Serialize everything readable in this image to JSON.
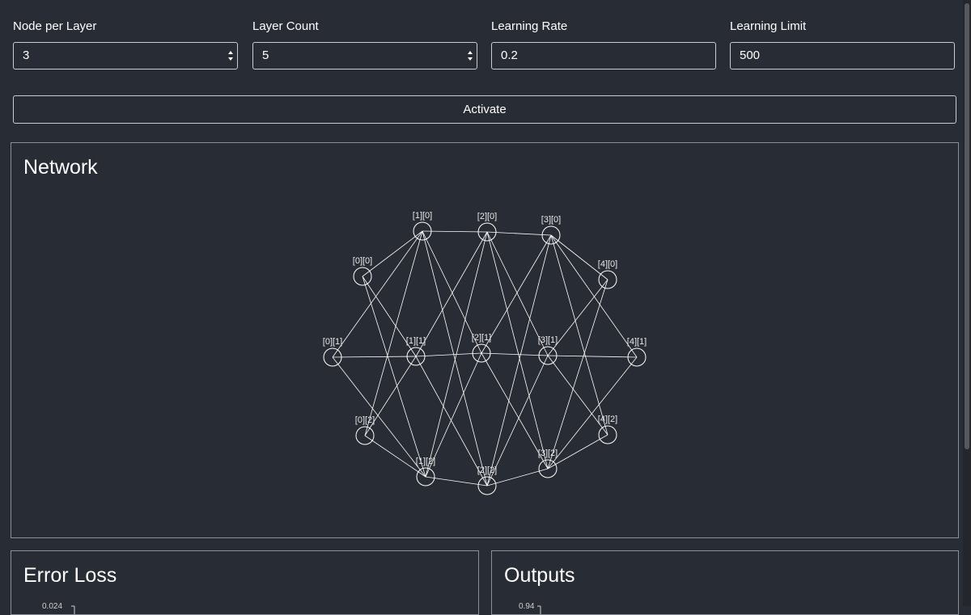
{
  "controls": {
    "node_per_layer": {
      "label": "Node per Layer",
      "value": "3"
    },
    "layer_count": {
      "label": "Layer Count",
      "value": "5"
    },
    "learning_rate": {
      "label": "Learning Rate",
      "value": "0.2"
    },
    "learning_limit": {
      "label": "Learning Limit",
      "value": "500"
    },
    "activate_label": "Activate"
  },
  "network": {
    "title": "Network",
    "nodes": [
      {
        "label": "[0][0]"
      },
      {
        "label": "[0][1]"
      },
      {
        "label": "[0][2]"
      },
      {
        "label": "[1][0]"
      },
      {
        "label": "[1][1]"
      },
      {
        "label": "[1][2]"
      },
      {
        "label": "[2][0]"
      },
      {
        "label": "[2][1]"
      },
      {
        "label": "[2][2]"
      },
      {
        "label": "[3][0]"
      },
      {
        "label": "[3][1]"
      },
      {
        "label": "[3][2]"
      },
      {
        "label": "[4][0]"
      },
      {
        "label": "[4][1]"
      },
      {
        "label": "[4][2]"
      }
    ]
  },
  "error_loss": {
    "title": "Error Loss",
    "top_tick": "0.024"
  },
  "outputs": {
    "title": "Outputs",
    "top_tick": "0.94"
  },
  "colors": {
    "background": "#282c34",
    "border": "#c9ccd1",
    "line": "#ffffff"
  }
}
